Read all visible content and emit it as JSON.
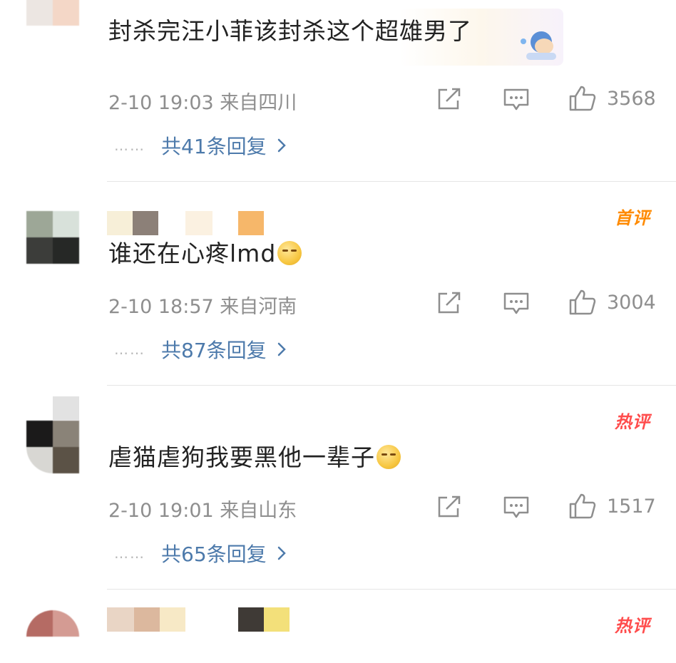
{
  "comments": [
    {
      "text": "封杀完汪小菲该封杀这个超雄男了",
      "meta": "2-10 19:03 来自四川",
      "likes": "3568",
      "replies": "共41条回复"
    },
    {
      "badge": "首评",
      "text": "谁还在心疼lmd",
      "meta": "2-10 18:57 来自河南",
      "likes": "3004",
      "replies": "共87条回复"
    },
    {
      "badge": "热评",
      "text": "虐猫虐狗我要黑他一辈子",
      "meta": "2-10 19:01 来自山东",
      "likes": "1517",
      "replies": "共65条回复"
    },
    {
      "badge": "热评"
    }
  ],
  "reply_dots": "……",
  "colors": {
    "reply_link": "#4d7aab",
    "first_badge": "#ff8a00",
    "hot_badge": "#ff4c4c",
    "meta_text": "#8e8e8e"
  },
  "icons": [
    "share-icon",
    "comment-icon",
    "like-icon",
    "chevron-right-icon",
    "emoji-icon"
  ]
}
